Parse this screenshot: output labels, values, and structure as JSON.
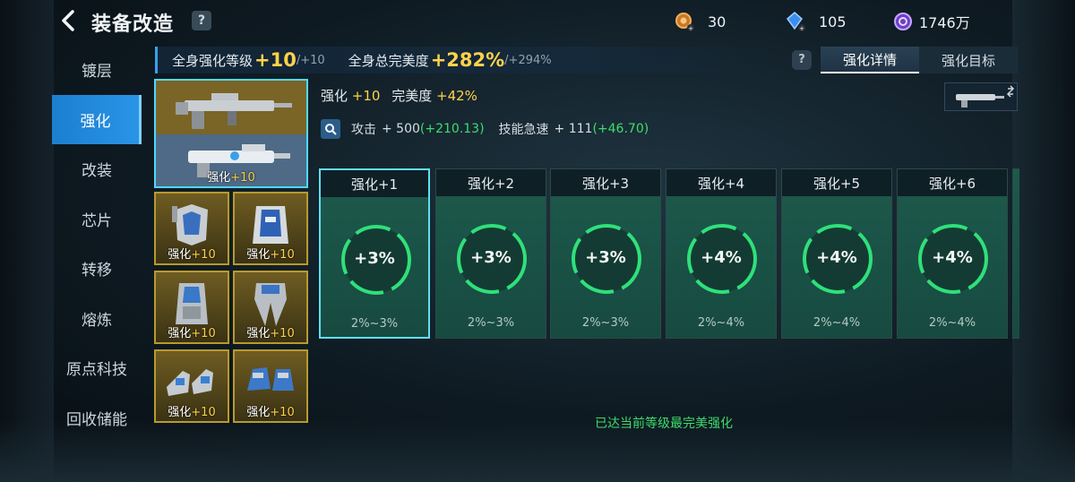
{
  "header": {
    "title": "装备改造",
    "help": "?",
    "resources": [
      {
        "icon": "bronze-medal-icon",
        "value": "30"
      },
      {
        "icon": "blue-crystal-icon",
        "value": "105"
      },
      {
        "icon": "purple-coin-icon",
        "value": "1746万"
      }
    ]
  },
  "nav": {
    "items": [
      "镀层",
      "强化",
      "改装",
      "芯片",
      "转移",
      "熔炼",
      "原点科技",
      "回收储能"
    ],
    "active": "强化"
  },
  "summary": {
    "level_label": "全身强化等级",
    "level_value": "+10",
    "level_max": "/+10",
    "perfect_label": "全身总完美度",
    "perfect_value": "+282%",
    "perfect_max": "/+294%"
  },
  "tabs": {
    "help": "?",
    "items": [
      "强化详情",
      "强化目标"
    ],
    "active": "强化详情"
  },
  "equipment": [
    {
      "icon": "rifle-icon",
      "label": "强化",
      "level": "+10"
    },
    {
      "icon": "chest-armor-icon",
      "label": "强化",
      "level": "+10"
    },
    {
      "icon": "vest-armor-icon",
      "label": "强化",
      "level": "+10"
    },
    {
      "icon": "arm-armor-icon",
      "label": "强化",
      "level": "+10"
    },
    {
      "icon": "leg-armor-icon",
      "label": "强化",
      "level": "+10"
    },
    {
      "icon": "boots-icon",
      "label": "强化",
      "level": "+10"
    },
    {
      "icon": "gloves-icon",
      "label": "强化",
      "level": "+10"
    }
  ],
  "detail": {
    "enhance_label": "强化",
    "enhance_value": "+10",
    "perfect_label": "完美度",
    "perfect_value": "+42%",
    "attack_label": "攻击",
    "attack_value": "+ 500",
    "attack_bonus": "(+210.13)",
    "skill_label": "技能急速",
    "skill_value": "+ 111",
    "skill_bonus": "(+46.70)"
  },
  "cards": [
    {
      "title": "强化+1",
      "percent": "+3%",
      "range": "2%~3%"
    },
    {
      "title": "强化+2",
      "percent": "+3%",
      "range": "2%~3%"
    },
    {
      "title": "强化+3",
      "percent": "+3%",
      "range": "2%~3%"
    },
    {
      "title": "强化+4",
      "percent": "+4%",
      "range": "2%~4%"
    },
    {
      "title": "强化+5",
      "percent": "+4%",
      "range": "2%~4%"
    },
    {
      "title": "强化+6",
      "percent": "+4%",
      "range": "2%~4%"
    }
  ],
  "status_message": "已达当前等级最完美强化"
}
